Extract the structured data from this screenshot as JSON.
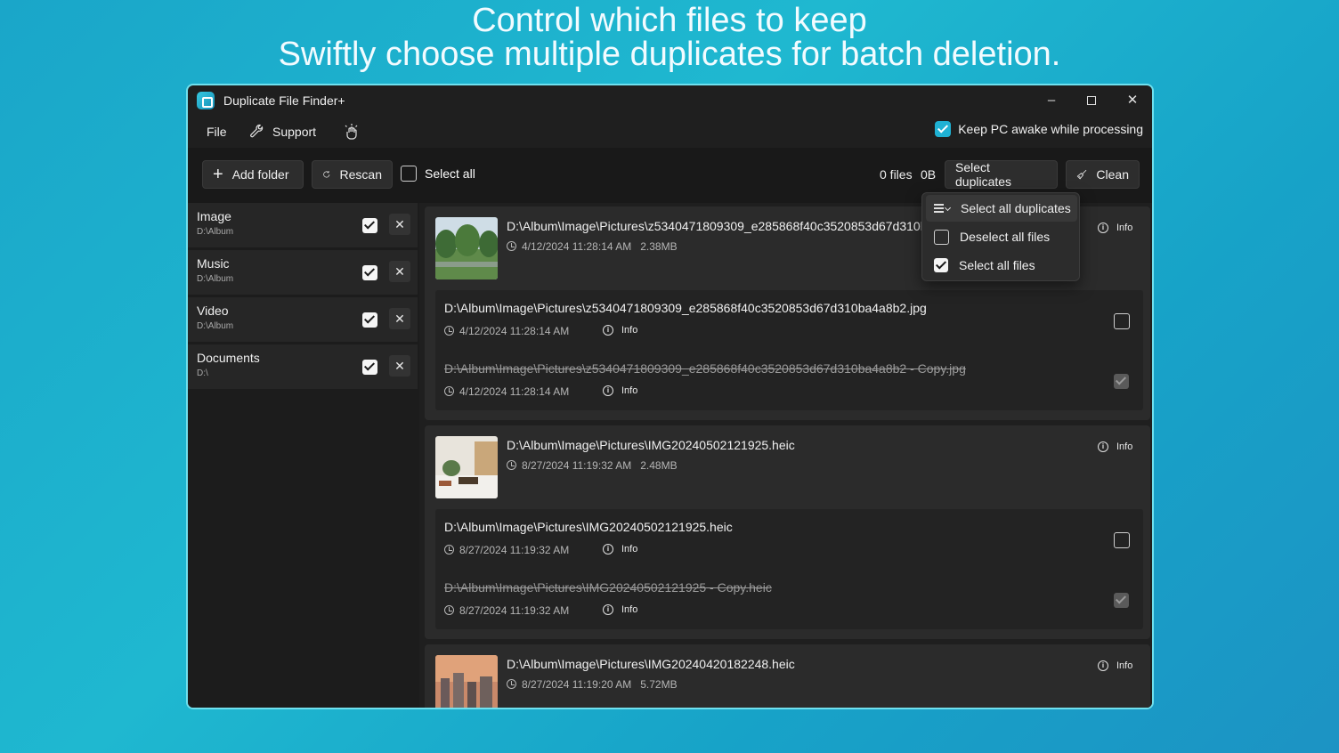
{
  "banner": {
    "line1": "Control which files to keep",
    "line2": "Swiftly choose multiple duplicates for batch deletion."
  },
  "app": {
    "title": "Duplicate File Finder+"
  },
  "menu": {
    "file": "File",
    "support": "Support"
  },
  "keep_awake": {
    "label": "Keep PC awake while processing",
    "checked": true
  },
  "toolbar": {
    "add_folder": "Add folder",
    "rescan": "Rescan",
    "select_all": "Select all",
    "file_count": "0 files",
    "size": "0B",
    "select_duplicates": "Select duplicates",
    "clean": "Clean"
  },
  "dropdown": {
    "items": [
      {
        "label": "Select all duplicates",
        "icon": "list-icon"
      },
      {
        "label": "Deselect all files",
        "icon": "checkbox-empty-icon"
      },
      {
        "label": "Select all files",
        "icon": "checkbox-checked-icon"
      }
    ]
  },
  "folders": [
    {
      "name": "Image",
      "path": "D:\\Album",
      "checked": true
    },
    {
      "name": "Music",
      "path": "D:\\Album",
      "checked": true
    },
    {
      "name": "Video",
      "path": "D:\\Album",
      "checked": true
    },
    {
      "name": "Documents",
      "path": "D:\\",
      "checked": true
    }
  ],
  "info_label": "Info",
  "groups": [
    {
      "path": "D:\\Album\\Image\\Pictures\\z5340471809309_e285868f40c3520853d67d310ba",
      "date": "4/12/2024 11:28:14 AM",
      "size": "2.38MB",
      "files": [
        {
          "path": "D:\\Album\\Image\\Pictures\\z5340471809309_e285868f40c3520853d67d310ba4a8b2.jpg",
          "date": "4/12/2024 11:28:14 AM",
          "selected": false
        },
        {
          "path": "D:\\Album\\Image\\Pictures\\z5340471809309_e285868f40c3520853d67d310ba4a8b2 - Copy.jpg",
          "date": "4/12/2024 11:28:14 AM",
          "selected": true
        }
      ]
    },
    {
      "path": "D:\\Album\\Image\\Pictures\\IMG20240502121925.heic",
      "date": "8/27/2024 11:19:32 AM",
      "size": "2.48MB",
      "files": [
        {
          "path": "D:\\Album\\Image\\Pictures\\IMG20240502121925.heic",
          "date": "8/27/2024 11:19:32 AM",
          "selected": false
        },
        {
          "path": "D:\\Album\\Image\\Pictures\\IMG20240502121925 - Copy.heic",
          "date": "8/27/2024 11:19:32 AM",
          "selected": true
        }
      ]
    },
    {
      "path": "D:\\Album\\Image\\Pictures\\IMG20240420182248.heic",
      "date": "8/27/2024 11:19:20 AM",
      "size": "5.72MB",
      "files": []
    }
  ]
}
